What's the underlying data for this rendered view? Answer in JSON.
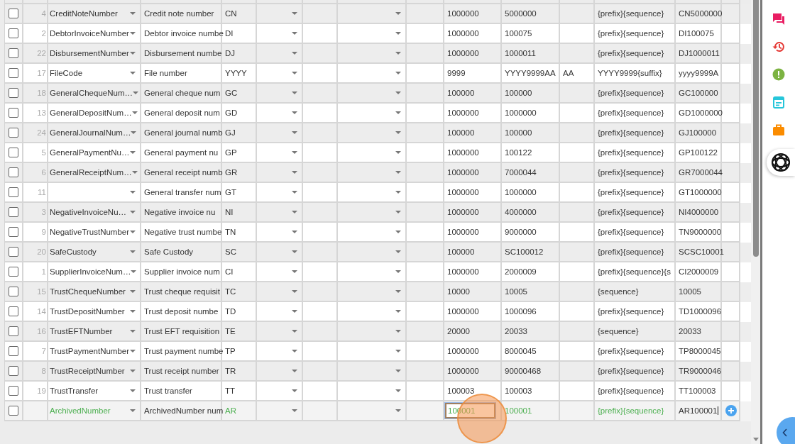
{
  "table": {
    "rows": [
      {
        "checked": false,
        "number": "4",
        "name": "CreditNoteNumber",
        "description": "Credit note number",
        "prefix": "CN",
        "start": "1000000",
        "next": "5000000",
        "format": "{prefix}{sequence}",
        "preview": "CN5000000"
      },
      {
        "checked": false,
        "number": "2",
        "name": "DebtorInvoiceNumber",
        "description": "Debtor invoice numbe",
        "prefix": "DI",
        "start": "1000000",
        "next": "100075",
        "format": "{prefix}{sequence}",
        "preview": "DI100075"
      },
      {
        "checked": false,
        "number": "22",
        "name": "DisbursementNumber",
        "description": "Disbursement numbe",
        "prefix": "DJ",
        "start": "1000000",
        "next": "1000011",
        "format": "{prefix}{sequence}",
        "preview": "DJ1000011"
      },
      {
        "checked": false,
        "number": "17",
        "name": "FileCode",
        "description": "File number",
        "prefix": "YYYY",
        "start": "9999",
        "next": "YYYY9999AA",
        "suffix": "AA",
        "format": "YYYY9999{suffix}",
        "preview": "yyyy9999A"
      },
      {
        "checked": false,
        "number": "18",
        "name": "GeneralChequeNum…",
        "description": "General cheque num",
        "prefix": "GC",
        "start": "100000",
        "next": "100000",
        "format": "{prefix}{sequence}",
        "preview": "GC100000"
      },
      {
        "checked": false,
        "number": "13",
        "name": "GeneralDepositNum…",
        "description": "General deposit num",
        "prefix": "GD",
        "start": "1000000",
        "next": "1000000",
        "format": "{prefix}{sequence}",
        "preview": "GD1000000"
      },
      {
        "checked": false,
        "number": "24",
        "name": "GeneralJournalNum…",
        "description": "General journal numb",
        "prefix": "GJ",
        "start": "100000",
        "next": "100000",
        "format": "{prefix}{sequence}",
        "preview": "GJ100000"
      },
      {
        "checked": false,
        "number": "5",
        "name": "GeneralPaymentNu…",
        "description": "General payment nu",
        "prefix": "GP",
        "start": "1000000",
        "next": "100122",
        "format": "{prefix}{sequence}",
        "preview": "GP100122"
      },
      {
        "checked": false,
        "number": "6",
        "name": "GeneralReceiptNum…",
        "description": "General receipt numb",
        "prefix": "GR",
        "start": "1000000",
        "next": "7000044",
        "format": "{prefix}{sequence}",
        "preview": "GR7000044"
      },
      {
        "checked": false,
        "number": "11",
        "description": "General transfer num",
        "prefix": "GT",
        "start": "1000000",
        "next": "1000000",
        "format": "{prefix}{sequence}",
        "preview": "GT1000000"
      },
      {
        "checked": false,
        "number": "3",
        "name": "NegativeInvoiceNu…",
        "description": "Negative invoice nu",
        "prefix": "NI",
        "start": "1000000",
        "next": "4000000",
        "format": "{prefix}{sequence}",
        "preview": "NI4000000"
      },
      {
        "checked": false,
        "number": "9",
        "name": "NegativeTrustNumber",
        "description": "Negative trust numbe",
        "prefix": "TN",
        "start": "1000000",
        "next": "9000000",
        "format": "{prefix}{sequence}",
        "preview": "TN9000000"
      },
      {
        "checked": false,
        "number": "20",
        "name": "SafeCustody",
        "description": "Safe Custody",
        "prefix": "SC",
        "start": "100000",
        "next": "SC100012",
        "format": "{prefix}{sequence}",
        "preview": "SCSC10001"
      },
      {
        "checked": false,
        "number": "1",
        "name": "SupplierInvoiceNum…",
        "description": "Supplier invoice num",
        "prefix": "CI",
        "start": "1000000",
        "next": "2000009",
        "format": "{prefix}{sequence}{s",
        "preview": "CI2000009"
      },
      {
        "checked": false,
        "number": "15",
        "name": "TrustChequeNumber",
        "description": "Trust cheque requisit",
        "prefix": "TC",
        "start": "10000",
        "next": "10005",
        "format": "{sequence}",
        "preview": "10005"
      },
      {
        "checked": false,
        "number": "14",
        "name": "TrustDepositNumber",
        "description": "Trust deposit numbe",
        "prefix": "TD",
        "start": "1000000",
        "next": "1000096",
        "format": "{prefix}{sequence}",
        "preview": "TD1000096"
      },
      {
        "checked": false,
        "number": "16",
        "name": "TrustEFTNumber",
        "description": "Trust EFT requisition",
        "prefix": "TE",
        "start": "20000",
        "next": "20033",
        "format": "{sequence}",
        "preview": "20033"
      },
      {
        "checked": false,
        "number": "7",
        "name": "TrustPaymentNumber",
        "description": "Trust payment numbe",
        "prefix": "TP",
        "start": "1000000",
        "next": "8000045",
        "format": "{prefix}{sequence}",
        "preview": "TP8000045"
      },
      {
        "checked": false,
        "number": "8",
        "name": "TrustReceiptNumber",
        "description": "Trust receipt number",
        "prefix": "TR",
        "start": "1000000",
        "next": "90000468",
        "format": "{prefix}{sequence}",
        "preview": "TR9000046"
      },
      {
        "checked": false,
        "number": "19",
        "name": "TrustTransfer",
        "description": "Trust transfer",
        "prefix": "TT",
        "start": "100003",
        "next": "100003",
        "format": "{prefix}{sequence}",
        "preview": "TT100003"
      },
      {
        "checked": false,
        "kind": "new",
        "name": "ArchivedNumber",
        "description": "ArchivedNumber num",
        "prefix": "AR",
        "start": "100001",
        "next": "100001",
        "format": "{prefix}{sequence}",
        "preview": "AR100001"
      }
    ]
  }
}
